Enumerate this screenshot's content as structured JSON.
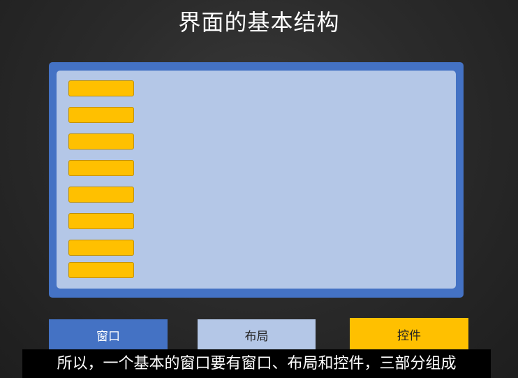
{
  "title": "界面的基本结构",
  "diagram": {
    "window_controls_count": 8
  },
  "legend": {
    "window_label": "窗口",
    "layout_label": "布局",
    "controls_label": "控件"
  },
  "subtitle": "所以，一个基本的窗口要有窗口、布局和控件，三部分组成",
  "colors": {
    "window": "#4472c4",
    "layout": "#b4c7e7",
    "control": "#ffc000",
    "background": "#2b2b2b"
  }
}
